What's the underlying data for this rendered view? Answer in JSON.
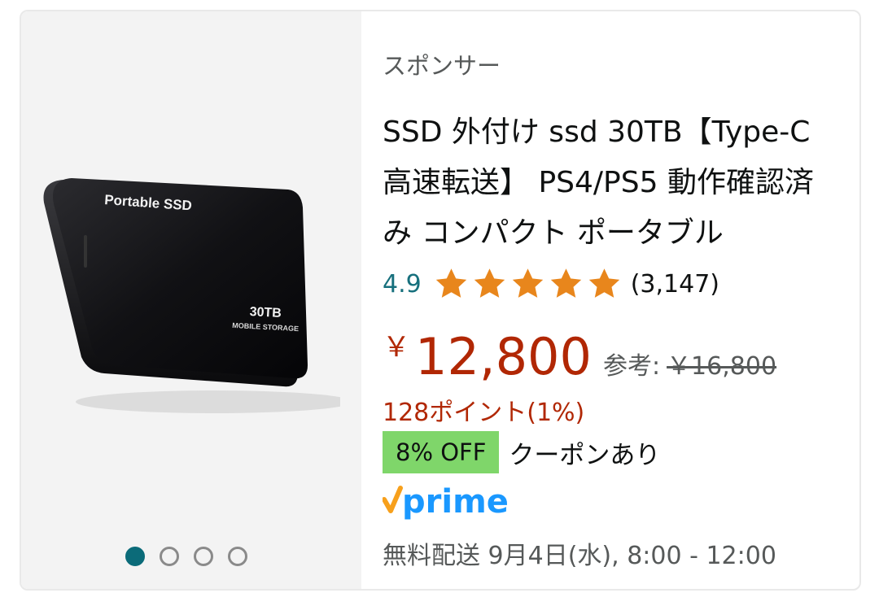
{
  "sponsored_label": "スポンサー",
  "product": {
    "title": "SSD 外付け ssd 30TB【Type-C 高速転送】 PS4/PS5 動作確認済み コンパクト ポータブル",
    "image_text": {
      "brand": "Portable SSD",
      "capacity": "30TB",
      "subtitle": "MOBILE STORAGE"
    },
    "rating": {
      "value": "4.9",
      "stars": 5,
      "review_count": "(3,147)"
    },
    "price": {
      "currency": "￥",
      "amount": "12,800",
      "reference_label": "参考:",
      "reference_price": "￥16,800"
    },
    "points": "128ポイント(1%)",
    "coupon": {
      "badge": "8% OFF",
      "text": "クーポンあり"
    },
    "prime_label": "prime",
    "delivery": "無料配送 9月4日(水), 8:00 - 12:00"
  },
  "carousel": {
    "total": 4,
    "active_index": 0
  },
  "colors": {
    "price": "#b12704",
    "rating": "#17707d",
    "star": "#e8861c",
    "coupon_badge": "#7fd66a",
    "prime": "#1a98ff",
    "active_dot": "#0b6b79"
  }
}
